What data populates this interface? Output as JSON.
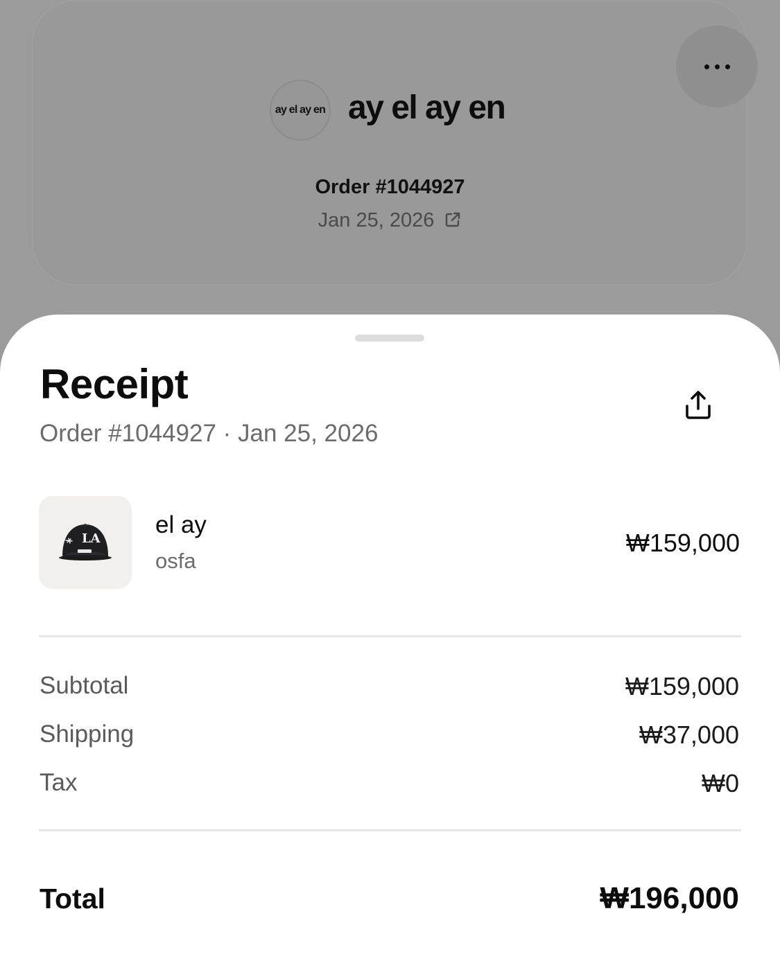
{
  "store_card": {
    "logo_text": "ay el ay en",
    "name": "ay el ay en",
    "order_label": "Order #1044927",
    "date": "Jan 25, 2026"
  },
  "icons": {
    "more": "more-horizontal-icon",
    "external_link": "external-link-icon",
    "share": "share-upload-icon"
  },
  "sheet": {
    "title": "Receipt",
    "subtitle": "Order #1044927 · Jan 25, 2026"
  },
  "line_items": [
    {
      "name": "el ay",
      "variant": "osfa",
      "price": "₩159,000",
      "image": "black LA baseball cap"
    }
  ],
  "summary": {
    "subtotal_label": "Subtotal",
    "subtotal_value": "₩159,000",
    "shipping_label": "Shipping",
    "shipping_value": "₩37,000",
    "tax_label": "Tax",
    "tax_value": "₩0",
    "total_label": "Total",
    "total_value": "₩196,000"
  },
  "colors": {
    "overlay_background": "#9b9b9b",
    "sheet_background": "#ffffff",
    "thumbnail_background": "#f2efec",
    "primary_text": "#0d0d0d",
    "secondary_text": "#6b6b6b"
  }
}
